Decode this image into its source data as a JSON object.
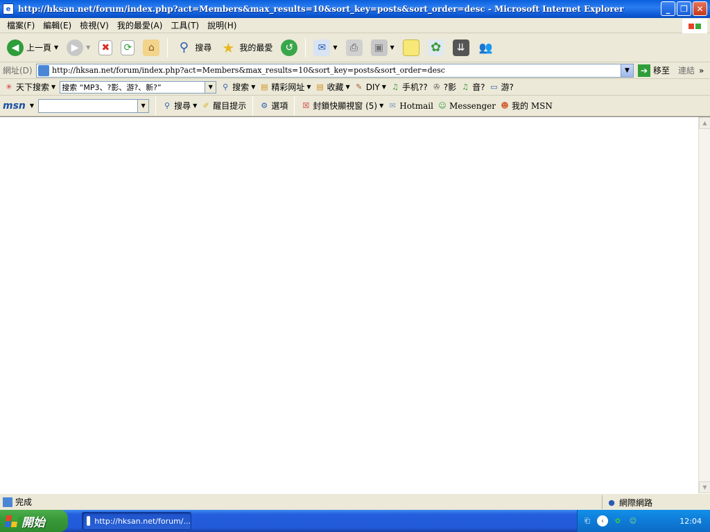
{
  "window": {
    "title": "http://hksan.net/forum/index.php?act=Members&max_results=10&sort_key=posts&sort_order=desc - Microsoft Internet Explorer"
  },
  "menu": [
    "檔案(F)",
    "編輯(E)",
    "檢視(V)",
    "我的最愛(A)",
    "工具(T)",
    "說明(H)"
  ],
  "toolbar": {
    "back_label": "上一頁",
    "search_label": "搜尋",
    "favorites_label": "我的最愛"
  },
  "address": {
    "label": "網址(D)",
    "url": "http://hksan.net/forum/index.php?act=Members&max_results=10&sort_key=posts&sort_order=desc",
    "go_label": "移至",
    "links_label": "連結"
  },
  "searchbar": {
    "brand": "天下搜索",
    "query": "搜索 “MP3、?影、游?、新?”",
    "search_label": "搜索",
    "sites_label": "精彩网址",
    "collect_label": "收藏",
    "diy_label": "DIY",
    "mobile_label": "手机??",
    "movie_label": "?影",
    "music_label": "音?",
    "game_label": "游?"
  },
  "msnbar": {
    "logo": "msn",
    "search_label": "搜尋",
    "alert_label": "醒目提示",
    "options_label": "選項",
    "popup_label": "封鎖快顯視窗 (5)",
    "hotmail_label": "Hotmail",
    "messenger_label": "Messenger",
    "mymsn_label": "我的 MSN"
  },
  "status": {
    "text": "完成",
    "zone": "網際網路"
  },
  "taskbar": {
    "start_label": "開始",
    "task_label": "http://hksan.net/forum/...",
    "lang": "CH",
    "ime": "速",
    "clock": "12:04"
  }
}
